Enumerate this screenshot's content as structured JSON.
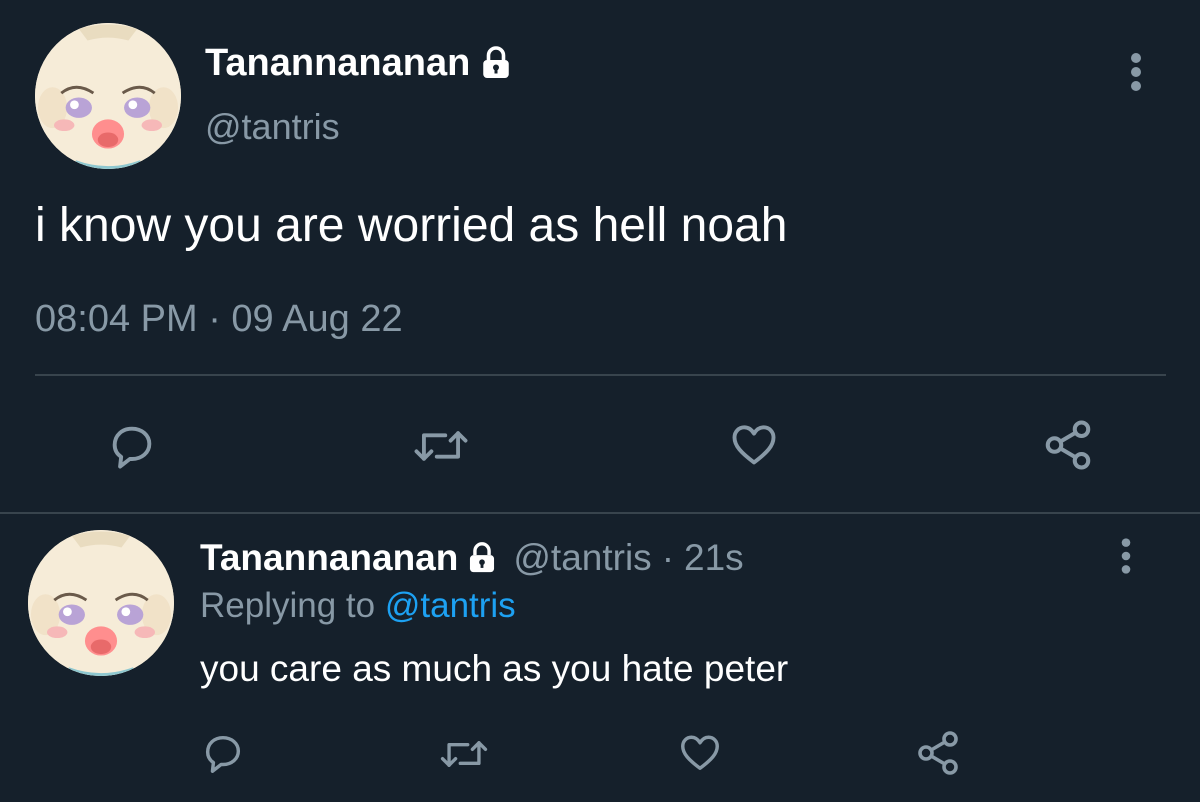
{
  "main_tweet": {
    "author_name": "Tanannananan",
    "handle": "@tantris",
    "text": "i know you are worried as hell noah",
    "timestamp": "08:04 PM · 09 Aug 22",
    "protected": true
  },
  "reply_tweet": {
    "author_name": "Tanannananan",
    "handle": "@tantris",
    "separator": "·",
    "age": "21s",
    "replying_prefix": "Replying to",
    "replying_to": "@tantris",
    "text": "you care as much as you hate peter",
    "protected": true
  },
  "colors": {
    "background": "#15202b",
    "text": "#ffffff",
    "muted": "#8899a6",
    "link": "#1da1f2",
    "divider": "#38444d"
  },
  "icons": [
    "lock-icon",
    "more-vertical-icon",
    "reply-icon",
    "retweet-icon",
    "like-icon",
    "share-icon"
  ]
}
